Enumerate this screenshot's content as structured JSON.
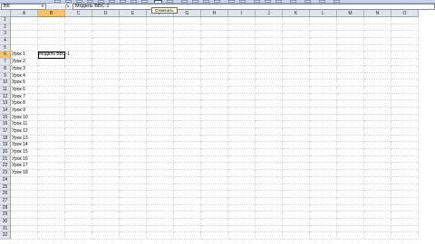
{
  "name_box": {
    "value": "B6",
    "dropdown_glyph": "▼"
  },
  "formula_bar": {
    "fx_glyph": "fx",
    "value": "Модель BBC-1"
  },
  "tooltip": {
    "text": "Отменить"
  },
  "columns": [
    "A",
    "B",
    "C",
    "D",
    "E",
    "F",
    "G",
    "H",
    "I",
    "J",
    "K",
    "L",
    "M",
    "N",
    "O"
  ],
  "active_column": "B",
  "rows": [
    "1",
    "2",
    "3",
    "4",
    "5",
    "6",
    "7",
    "8",
    "9",
    "10",
    "11",
    "12",
    "13",
    "14",
    "15",
    "16",
    "17",
    "18",
    "19",
    "20",
    "21",
    "22",
    "23",
    "24",
    "25",
    "26",
    "27",
    "28",
    "29",
    "30",
    "31",
    "32"
  ],
  "active_row": "6",
  "cells": {
    "A6": "Урок 1",
    "B6": "Модель BBC-1",
    "A7": "Урок 2",
    "A8": "Урок 3",
    "A9": "Урок 4",
    "A10": "Урок 5",
    "A11": "Урок 6",
    "A12": "Урок 7",
    "A13": "Урок 8",
    "A14": "Урок 9",
    "A15": "Урок 10",
    "A16": "Урок 11",
    "A17": "Урок 12",
    "A18": "Урок 13",
    "A19": "Урок 14",
    "A20": "Урок 15",
    "A21": "Урок 16",
    "A22": "Урок 17",
    "A23": "Урок 18"
  },
  "selected_cell": "B6",
  "colors": {
    "header_bg": "#dfe3ea",
    "active_header": "#f4c36b",
    "toolbar": "#c6d3e8"
  }
}
